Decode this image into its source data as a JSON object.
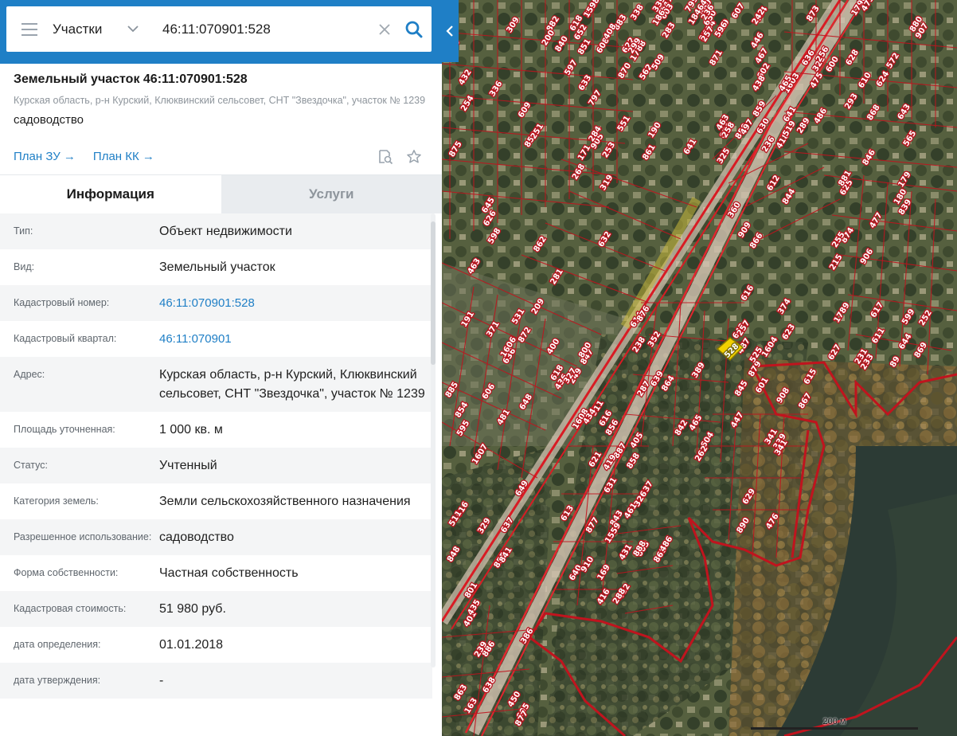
{
  "search": {
    "type_label": "Участки",
    "query": "46:11:070901:528"
  },
  "parcel": {
    "title": "Земельный участок 46:11:070901:528",
    "address": "Курская область, р-н Курский, Клюквинский сельсовет, СНТ \"Звездочка\", участок № 1239",
    "use": "садоводство",
    "links": [
      "План ЗУ →",
      "План КК →"
    ]
  },
  "tabs": [
    {
      "label": "Информация"
    },
    {
      "label": "Услуги"
    }
  ],
  "info": [
    {
      "key": "Тип:",
      "value": "Объект недвижимости"
    },
    {
      "key": "Вид:",
      "value": "Земельный участок"
    },
    {
      "key": "Кадастровый номер:",
      "value": "46:11:070901:528"
    },
    {
      "key": "Кадастровый квартал:",
      "value": "46:11:070901"
    },
    {
      "key": "Адрес:",
      "value": "Курская область, р-н Курский, Клюквинский сельсовет, СНТ \"Звездочка\", участок № 1239"
    },
    {
      "key": "Площадь уточненная:",
      "value": "1 000 кв. м"
    },
    {
      "key": "Статус:",
      "value": "Учтенный"
    },
    {
      "key": "Категория земель:",
      "value": "Земли сельскохозяйственного назначения"
    },
    {
      "key": "Разрешенное использование:",
      "value": "садоводство"
    },
    {
      "key": "Форма собственности:",
      "value": "Частная собственность"
    },
    {
      "key": "Кадастровая стоимость:",
      "value": "51 980 руб."
    },
    {
      "key": "дата определения:",
      "value": "01.01.2018"
    },
    {
      "key": "дата утверждения:",
      "value": "-"
    }
  ],
  "map": {
    "scale_label": "200 м",
    "selected_label": "528",
    "plot_labels": [
      "850",
      "851",
      "853",
      "854",
      "855",
      "856",
      "858",
      "859",
      "623",
      "624",
      "625",
      "632",
      "633",
      "634",
      "636",
      "637",
      "621",
      "631",
      "630",
      "629",
      "628",
      "627",
      "626",
      "622",
      "619",
      "618",
      "616",
      "614",
      "613",
      "612",
      "615",
      "610",
      "611",
      "609",
      "608",
      "607",
      "606",
      "605",
      "604",
      "603",
      "602",
      "601",
      "600",
      "599",
      "598",
      "597",
      "596",
      "595",
      "638",
      "639",
      "640",
      "641",
      "642",
      "643",
      "644",
      "645",
      "646",
      "647",
      "648",
      "649",
      "876",
      "877",
      "878",
      "879",
      "880",
      "881",
      "882",
      "883",
      "884",
      "885",
      "886",
      "887",
      "888",
      "889",
      "890",
      "873",
      "874",
      "875",
      "870",
      "871",
      "872",
      "863",
      "864",
      "865",
      "866",
      "867",
      "868",
      "869",
      "862",
      "861",
      "860",
      "847",
      "841",
      "842",
      "843",
      "844",
      "845",
      "846",
      "839",
      "840",
      "797",
      "799",
      "800",
      "848",
      "911",
      "910",
      "909",
      "908",
      "907",
      "906",
      "905",
      "652",
      "650",
      "1606",
      "1607",
      "1608",
      "1559",
      "1603",
      "1604",
      "1790",
      "1789",
      "1598",
      "1788",
      "18464",
      "400",
      "401",
      "262",
      "416",
      "418",
      "487",
      "486",
      "89",
      "336",
      "408",
      "446",
      "436",
      "435",
      "434",
      "486",
      "497",
      "339",
      "325",
      "252",
      "251",
      "562",
      "603",
      "481",
      "450",
      "405",
      "419",
      "519",
      "525",
      "636",
      "233",
      "171",
      "338",
      "236",
      "531",
      "801",
      "352",
      "431",
      "438",
      "447",
      "473",
      "180",
      "432",
      "551",
      "467",
      "463",
      "877",
      "465",
      "462",
      "463",
      "374",
      "572",
      "231",
      "200",
      "190",
      "186",
      "191",
      "511",
      "287",
      "288",
      "258",
      "257",
      "256",
      "255",
      "254",
      "253",
      "257",
      "249",
      "239",
      "238",
      "237",
      "236",
      "476",
      "475",
      "477",
      "268",
      "284",
      "283",
      "281",
      "329",
      "327",
      "326",
      "325",
      "341",
      "289",
      "617",
      "618",
      "641",
      "242",
      "371",
      "386",
      "389",
      "169",
      "360",
      "341",
      "293",
      "215",
      "309",
      "299",
      "509",
      "209",
      "163",
      "616",
      "461",
      "465",
      "616",
      "565",
      "179",
      "415",
      "319",
      "339"
    ],
    "colors": {
      "parcel_border": "#c0141e",
      "road": "#d81c24",
      "selected": "#f2d000"
    }
  }
}
